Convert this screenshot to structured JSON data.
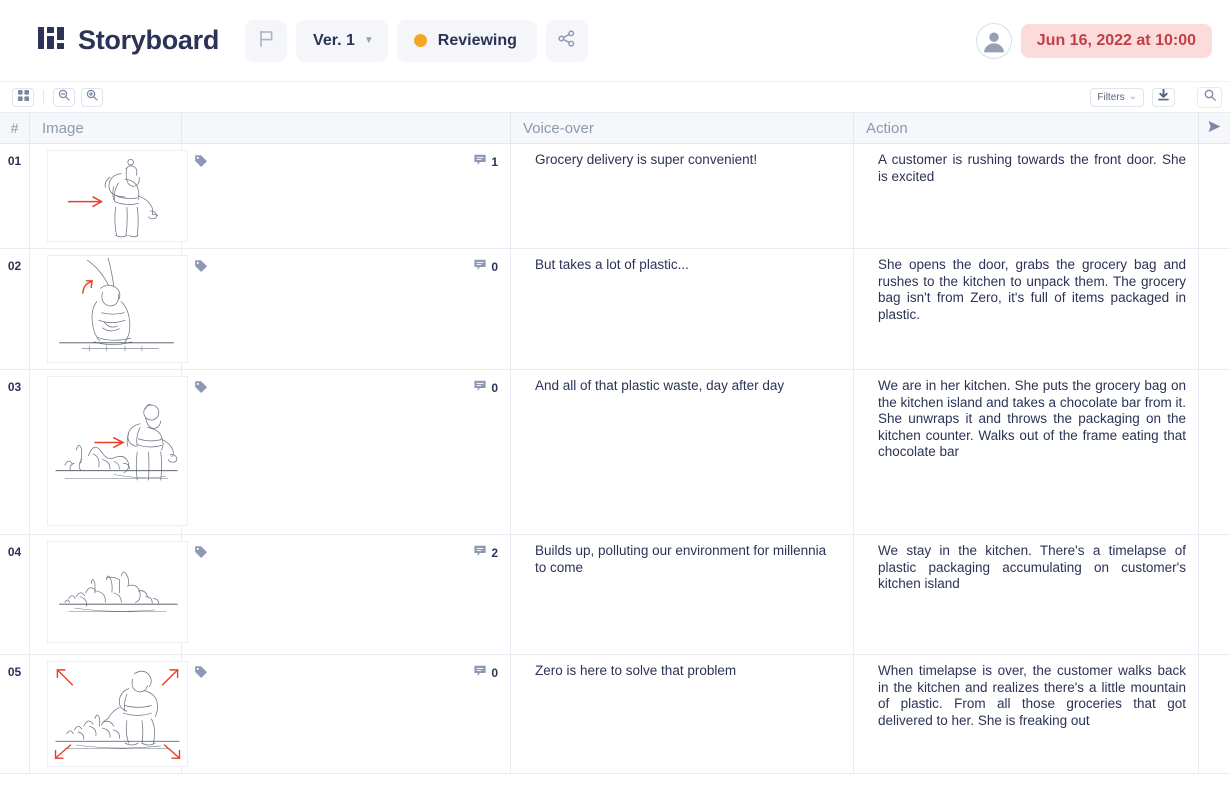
{
  "header": {
    "logo_icon": "grid-logo-icon",
    "title": "Storyboard",
    "flag_icon": "flag-icon",
    "version_label": "Ver. 1",
    "version_chevron": "chevron-down-icon",
    "status_label": "Reviewing",
    "status_color": "#f5a623",
    "share_icon": "share-icon",
    "avatar_icon": "user-avatar-icon",
    "date_badge": "Jun 16, 2022 at 10:00",
    "date_badge_bg": "#fbdcda",
    "date_badge_color": "#c0404a"
  },
  "toolbar": {
    "grid_view_icon": "grid-view-icon",
    "zoom_out_icon": "zoom-out-icon",
    "zoom_in_icon": "zoom-in-icon",
    "filters_label": "Filters",
    "filters_chevron": "chevron-down-icon",
    "download_icon": "download-icon",
    "search_icon": "search-icon"
  },
  "table": {
    "columns": {
      "number": "#",
      "image": "Image",
      "notes": "",
      "voice_over": "Voice-over",
      "action": "Action",
      "send_icon": "send-icon"
    },
    "rows": [
      {
        "number": "01",
        "tag_icon": "tag-icon",
        "comment_icon": "comment-icon",
        "comments": "1",
        "voice_over": "Grocery delivery is super convenient!",
        "action": "A customer is rushing towards the front door. She is excited",
        "sketch": "woman-walking-with-backpack-red-arrow"
      },
      {
        "number": "02",
        "tag_icon": "tag-icon",
        "comment_icon": "comment-icon",
        "comments": "0",
        "voice_over": "But takes a lot of plastic...",
        "action": "She opens the door, grabs the grocery bag and rushes to the kitchen to unpack them. The grocery bag isn't from Zero, it's full of items packaged in plastic.",
        "sketch": "person-crouching-curved-red-arrow"
      },
      {
        "number": "03",
        "tag_icon": "tag-icon",
        "comment_icon": "comment-icon",
        "comments": "0",
        "voice_over": "And all of that plastic waste, day after day",
        "action": "We are in her kitchen. She puts the grocery bag on the kitchen island and takes a chocolate bar from it. She unwraps it and throws the packaging on the kitchen counter. Walks out of the frame eating that chocolate bar",
        "sketch": "woman-beside-pile-of-trash-red-arrow"
      },
      {
        "number": "04",
        "tag_icon": "tag-icon",
        "comment_icon": "comment-icon",
        "comments": "2",
        "voice_over": "Builds up, polluting our environment for millennia to come",
        "action": "We stay in the kitchen. There's a timelapse of plastic packaging accumulating on customer's kitchen island",
        "sketch": "pile-of-plastic-waste"
      },
      {
        "number": "05",
        "tag_icon": "tag-icon",
        "comment_icon": "comment-icon",
        "comments": "0",
        "voice_over": "Zero is here to solve that problem",
        "action": "When timelapse is over, the customer walks back in the kitchen and realizes there's a little mountain of plastic. From all those groceries that got delivered to her. She is freaking out",
        "sketch": "woman-sitting-on-mountain-of-plastic-four-red-arrows"
      }
    ]
  }
}
